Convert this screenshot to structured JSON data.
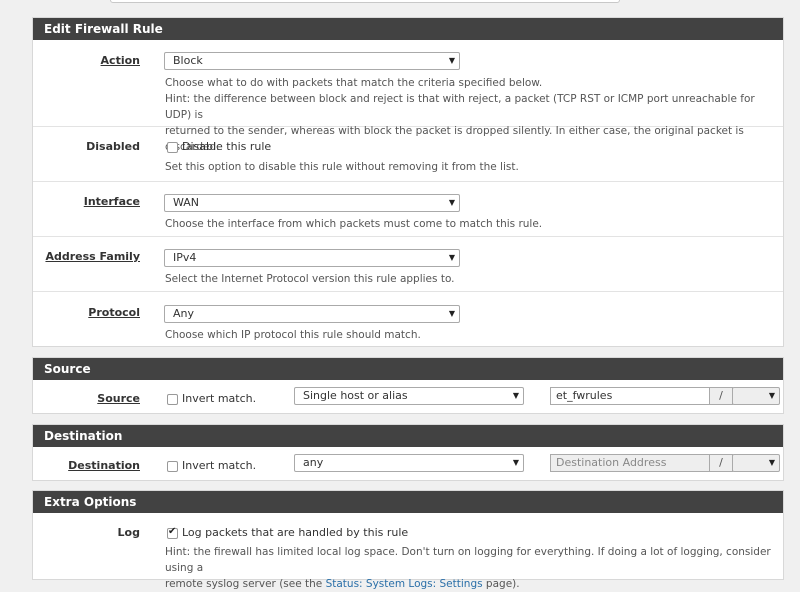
{
  "edit_rule": {
    "header": "Edit Firewall Rule",
    "action": {
      "label": "Action",
      "value": "Block",
      "help1": "Choose what to do with packets that match the criteria specified below.",
      "help2": "Hint: the difference between block and reject is that with reject, a packet (TCP RST or ICMP port unreachable for UDP) is",
      "help3": "returned to the sender, whereas with block the packet is dropped silently. In either case, the original packet is discarded."
    },
    "disabled": {
      "label": "Disabled",
      "checkbox_label": "Disable this rule",
      "checked": false,
      "help": "Set this option to disable this rule without removing it from the list."
    },
    "interface": {
      "label": "Interface",
      "value": "WAN",
      "help": "Choose the interface from which packets must come to match this rule."
    },
    "address_family": {
      "label": "Address Family",
      "value": "IPv4",
      "help": "Select the Internet Protocol version this rule applies to."
    },
    "protocol": {
      "label": "Protocol",
      "value": "Any",
      "help": "Choose which IP protocol this rule should match."
    }
  },
  "source": {
    "header": "Source",
    "label": "Source",
    "invert_label": "Invert match.",
    "invert_checked": false,
    "type_value": "Single host or alias",
    "address_value": "et_fwrules",
    "slash": "/",
    "mask_value": ""
  },
  "destination": {
    "header": "Destination",
    "label": "Destination",
    "invert_label": "Invert match.",
    "invert_checked": false,
    "type_value": "any",
    "address_placeholder": "Destination Address",
    "slash": "/",
    "mask_value": ""
  },
  "extra_options": {
    "header": "Extra Options",
    "log": {
      "label": "Log",
      "checkbox_label": "Log packets that are handled by this rule",
      "checked": true,
      "help1": "Hint: the firewall has limited local log space. Don't turn on logging for everything. If doing a lot of logging, consider using a",
      "help2_prefix": "remote syslog server (see the ",
      "help2_link": "Status: System Logs: Settings",
      "help2_suffix": " page)."
    }
  },
  "icons": {
    "dropdown": "chevron-down-icon",
    "checkbox": "checkbox-icon"
  },
  "colors": {
    "panel_header": "#424242",
    "link": "#2a6fa8"
  }
}
